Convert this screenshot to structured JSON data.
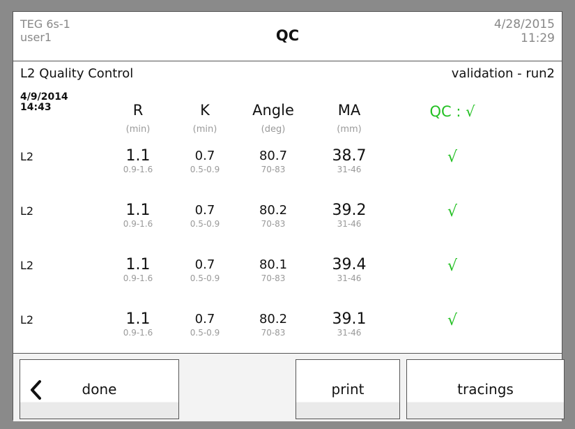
{
  "header": {
    "device": "TEG 6s-1",
    "user": "user1",
    "title": "QC",
    "date": "4/28/2015",
    "time": "11:29"
  },
  "subheader": {
    "left": "L2 Quality Control",
    "right": "validation - run2"
  },
  "run": {
    "date": "4/9/2014",
    "time": "14:43"
  },
  "columns": [
    {
      "name": "R",
      "unit": "(min)"
    },
    {
      "name": "K",
      "unit": "(min)"
    },
    {
      "name": "Angle",
      "unit": "(deg)"
    },
    {
      "name": "MA",
      "unit": "(mm)"
    }
  ],
  "qc_header": "QC : √",
  "rows": [
    {
      "label": "L2",
      "r": "1.1",
      "r_range": "0.9-1.6",
      "k": "0.7",
      "k_range": "0.5-0.9",
      "angle": "80.7",
      "angle_range": "70-83",
      "ma": "38.7",
      "ma_range": "31-46",
      "check": "√"
    },
    {
      "label": "L2",
      "r": "1.1",
      "r_range": "0.9-1.6",
      "k": "0.7",
      "k_range": "0.5-0.9",
      "angle": "80.2",
      "angle_range": "70-83",
      "ma": "39.2",
      "ma_range": "31-46",
      "check": "√"
    },
    {
      "label": "L2",
      "r": "1.1",
      "r_range": "0.9-1.6",
      "k": "0.7",
      "k_range": "0.5-0.9",
      "angle": "80.1",
      "angle_range": "70-83",
      "ma": "39.4",
      "ma_range": "31-46",
      "check": "√"
    },
    {
      "label": "L2",
      "r": "1.1",
      "r_range": "0.9-1.6",
      "k": "0.7",
      "k_range": "0.5-0.9",
      "angle": "80.2",
      "angle_range": "70-83",
      "ma": "39.1",
      "ma_range": "31-46",
      "check": "√"
    }
  ],
  "buttons": {
    "done": "done",
    "print": "print",
    "tracings": "tracings",
    "back_icon": "chevron-left-icon"
  },
  "colors": {
    "accent": "#22c022",
    "frame": "#8a8a8a"
  }
}
